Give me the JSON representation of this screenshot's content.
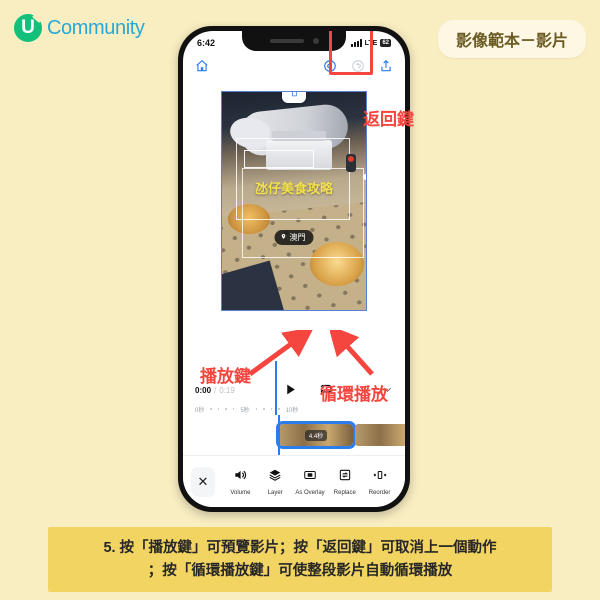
{
  "brand": {
    "mark": "U",
    "word": "Community"
  },
  "corner_badge": {
    "label": "影像範本－影片"
  },
  "phone": {
    "status_bar": {
      "time": "6:42",
      "network": "LTE",
      "battery": "62"
    },
    "app_toolbar": {
      "home_icon": "home-icon",
      "undo_icon": "undo-icon",
      "redo_icon": "redo-icon",
      "share_icon": "share-icon"
    },
    "video": {
      "overlay_text": "氹仔美食攻略",
      "location_tag": "澳門",
      "trash_icon": "trash-icon"
    },
    "transport": {
      "current_time": "0:00",
      "separator": "/",
      "total_time": "0:19",
      "play_icon": "play-icon",
      "loop_icon": "loop-icon",
      "collapse_icon": "chevron-down-icon"
    },
    "ruler": {
      "ticks": [
        "0秒",
        "5秒",
        "10秒"
      ]
    },
    "timeline": {
      "selected_clip_duration": "4.4秒",
      "handle_left": "‹",
      "handle_right": "›"
    },
    "bottom_bar": {
      "close_label": "✕",
      "tools": [
        {
          "icon": "volume-icon",
          "label": "Volume"
        },
        {
          "icon": "layer-icon",
          "label": "Layer"
        },
        {
          "icon": "as-overlay-icon",
          "label": "As Overlay"
        },
        {
          "icon": "replace-icon",
          "label": "Replace"
        },
        {
          "icon": "reorder-icon",
          "label": "Reorder"
        }
      ]
    }
  },
  "annotations": {
    "back_button": "返回鍵",
    "play_button": "播放鍵",
    "loop_playback": "循環播放"
  },
  "caption": {
    "line1": "5. 按「播放鍵」可預覽影片；按「返回鍵」可取消上一個動作",
    "line2": "；按「循環播放鍵」可使整段影片自動循環播放"
  },
  "colors": {
    "page_background": "#f9eec2",
    "caption_background": "#f2d462",
    "annotation_red": "#f4453f",
    "accent_blue": "#2b7ced",
    "brand_green": "#13c07a",
    "brand_blue": "#26a8d8",
    "overlay_yellow": "#f4e24c"
  }
}
